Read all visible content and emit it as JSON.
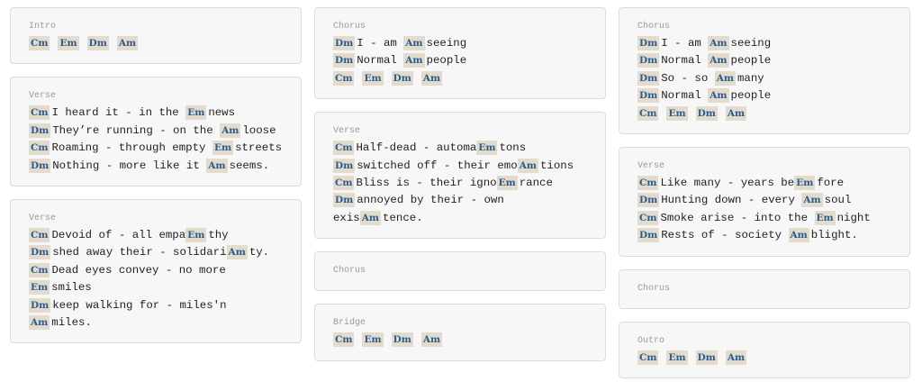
{
  "columns": [
    [
      {
        "label": "Intro",
        "chords": [
          "Cm",
          "Em",
          "Dm",
          "Am"
        ]
      },
      {
        "label": "Verse",
        "lines": [
          [
            {
              "c": "Cm"
            },
            {
              "t": "I heard it - in the "
            },
            {
              "c": "Em"
            },
            {
              "t": "news"
            }
          ],
          [
            {
              "c": "Dm"
            },
            {
              "t": "They’re running - on the "
            },
            {
              "c": "Am"
            },
            {
              "t": "loose"
            }
          ],
          [
            {
              "c": "Cm"
            },
            {
              "t": "Roaming - through empty "
            },
            {
              "c": "Em"
            },
            {
              "t": "streets"
            }
          ],
          [
            {
              "c": "Dm"
            },
            {
              "t": "Nothing - more like it "
            },
            {
              "c": "Am"
            },
            {
              "t": "seems."
            }
          ]
        ]
      },
      {
        "label": "Verse",
        "lines": [
          [
            {
              "c": "Cm"
            },
            {
              "t": "Devoid of - all empa"
            },
            {
              "c": "Em"
            },
            {
              "t": "thy"
            }
          ],
          [
            {
              "c": "Dm"
            },
            {
              "t": "shed away their - solidari"
            },
            {
              "c": "Am"
            },
            {
              "t": "ty."
            }
          ],
          [
            {
              "c": "Cm"
            },
            {
              "t": "Dead eyes convey - no more"
            }
          ],
          [
            {
              "c": "Em"
            },
            {
              "t": "smiles"
            }
          ],
          [
            {
              "c": "Dm"
            },
            {
              "t": "keep walking for - miles'n"
            }
          ],
          [
            {
              "c": "Am"
            },
            {
              "t": "miles."
            }
          ]
        ]
      }
    ],
    [
      {
        "label": "Chorus",
        "lines": [
          [
            {
              "c": "Dm"
            },
            {
              "t": "I - am "
            },
            {
              "c": "Am"
            },
            {
              "t": "seeing"
            }
          ],
          [
            {
              "c": "Dm"
            },
            {
              "t": "Normal "
            },
            {
              "c": "Am"
            },
            {
              "t": "people"
            }
          ]
        ],
        "chords": [
          "Cm",
          "Em",
          "Dm",
          "Am"
        ]
      },
      {
        "label": "Verse",
        "lines": [
          [
            {
              "c": "Cm"
            },
            {
              "t": "Half-dead - automa"
            },
            {
              "c": "Em"
            },
            {
              "t": "tons"
            }
          ],
          [
            {
              "c": "Dm"
            },
            {
              "t": "switched off - their emo"
            },
            {
              "c": "Am"
            },
            {
              "t": "tions"
            }
          ],
          [
            {
              "c": "Cm"
            },
            {
              "t": "Bliss is - their igno"
            },
            {
              "c": "Em"
            },
            {
              "t": "rance"
            }
          ],
          [
            {
              "c": "Dm"
            },
            {
              "t": "annoyed by their - own"
            }
          ],
          [
            {
              "t": "exis"
            },
            {
              "c": "Am"
            },
            {
              "t": "tence."
            }
          ]
        ]
      },
      {
        "label": "Chorus"
      },
      {
        "label": "Bridge",
        "chords": [
          "Cm",
          "Em",
          "Dm",
          "Am"
        ]
      }
    ],
    [
      {
        "label": "Chorus",
        "lines": [
          [
            {
              "c": "Dm"
            },
            {
              "t": "I - am "
            },
            {
              "c": "Am"
            },
            {
              "t": "seeing"
            }
          ],
          [
            {
              "c": "Dm"
            },
            {
              "t": "Normal "
            },
            {
              "c": "Am"
            },
            {
              "t": "people"
            }
          ],
          [
            {
              "c": "Dm"
            },
            {
              "t": "So - so "
            },
            {
              "c": "Am"
            },
            {
              "t": "many"
            }
          ],
          [
            {
              "c": "Dm"
            },
            {
              "t": "Normal "
            },
            {
              "c": "Am"
            },
            {
              "t": "people"
            }
          ]
        ],
        "chords": [
          "Cm",
          "Em",
          "Dm",
          "Am"
        ]
      },
      {
        "label": "Verse",
        "lines": [
          [
            {
              "c": "Cm"
            },
            {
              "t": "Like many - years be"
            },
            {
              "c": "Em"
            },
            {
              "t": "fore"
            }
          ],
          [
            {
              "c": "Dm"
            },
            {
              "t": "Hunting down - every "
            },
            {
              "c": "Am"
            },
            {
              "t": "soul"
            }
          ],
          [
            {
              "c": "Cm"
            },
            {
              "t": "Smoke arise - into the "
            },
            {
              "c": "Em"
            },
            {
              "t": "night"
            }
          ],
          [
            {
              "c": "Dm"
            },
            {
              "t": "Rests of - society "
            },
            {
              "c": "Am"
            },
            {
              "t": "blight."
            }
          ]
        ]
      },
      {
        "label": "Chorus"
      },
      {
        "label": "Outro",
        "chords": [
          "Cm",
          "Em",
          "Dm",
          "Am"
        ]
      }
    ]
  ]
}
